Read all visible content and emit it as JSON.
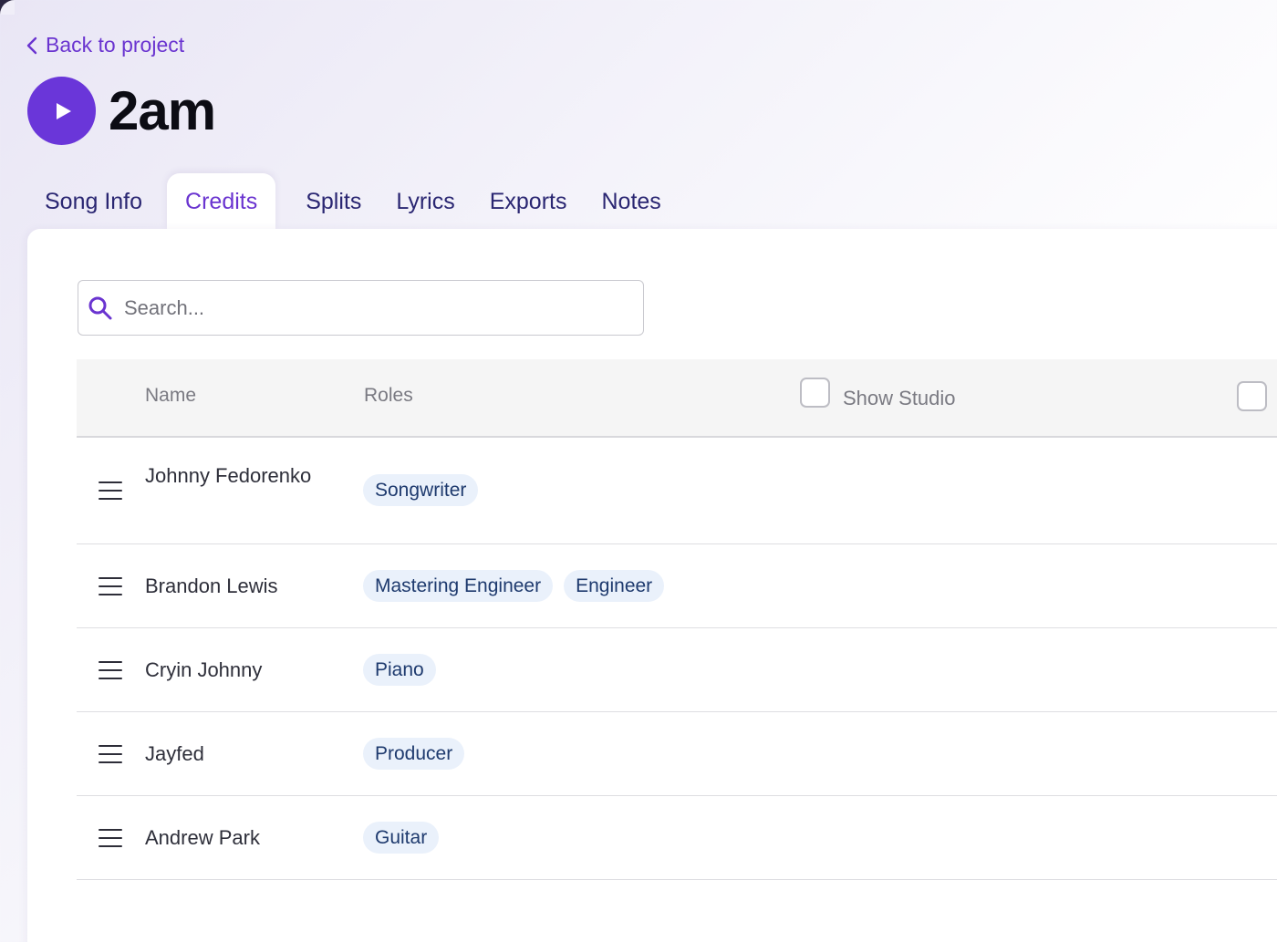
{
  "nav": {
    "back_label": "Back to project"
  },
  "song": {
    "title": "2am"
  },
  "tabs": [
    {
      "label": "Song Info",
      "active": false
    },
    {
      "label": "Credits",
      "active": true
    },
    {
      "label": "Splits",
      "active": false
    },
    {
      "label": "Lyrics",
      "active": false
    },
    {
      "label": "Exports",
      "active": false
    },
    {
      "label": "Notes",
      "active": false
    }
  ],
  "search": {
    "placeholder": "Search..."
  },
  "table": {
    "columns": {
      "name": "Name",
      "roles": "Roles",
      "show_studio": "Show Studio"
    },
    "rows": [
      {
        "name": "Johnny Fedorenko",
        "roles": [
          "Songwriter"
        ]
      },
      {
        "name": "Brandon Lewis",
        "roles": [
          "Mastering Engineer",
          "Engineer"
        ]
      },
      {
        "name": "Cryin Johnny",
        "roles": [
          "Piano"
        ]
      },
      {
        "name": "Jayfed",
        "roles": [
          "Producer"
        ]
      },
      {
        "name": "Andrew Park",
        "roles": [
          "Guitar"
        ]
      }
    ]
  },
  "colors": {
    "accent": "#6a34d0",
    "tab_text": "#2a2672",
    "chip_bg": "#eaf1fb",
    "chip_text": "#1e3a6e"
  }
}
